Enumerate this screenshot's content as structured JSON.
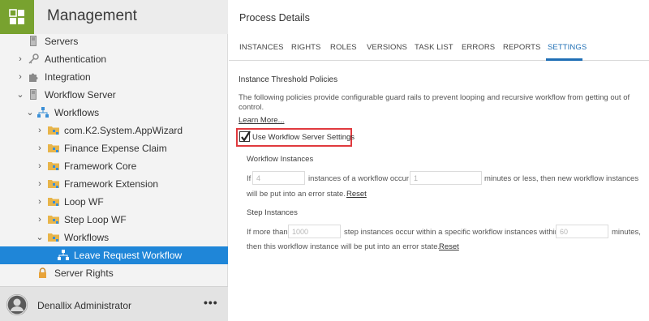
{
  "sidebar": {
    "title": "Management",
    "brand_color": "#78a22f",
    "selected_color": "#1f86d8",
    "tree": [
      {
        "label": "Servers",
        "icon": "server-icon",
        "chevron": ""
      },
      {
        "label": "Authentication",
        "icon": "key-icon",
        "chevron": "›"
      },
      {
        "label": "Integration",
        "icon": "puzzle-icon",
        "chevron": "›"
      },
      {
        "label": "Workflow Server",
        "icon": "server-icon",
        "chevron": "⌄"
      },
      {
        "label": "Workflows",
        "icon": "workflow-icon",
        "chevron": "⌄"
      },
      {
        "label": "com.K2.System.AppWizard",
        "icon": "folder-workflow-icon",
        "chevron": "›"
      },
      {
        "label": "Finance Expense Claim",
        "icon": "folder-workflow-icon",
        "chevron": "›"
      },
      {
        "label": "Framework Core",
        "icon": "folder-workflow-icon",
        "chevron": "›"
      },
      {
        "label": "Framework Extension",
        "icon": "folder-workflow-icon",
        "chevron": "›"
      },
      {
        "label": "Loop WF",
        "icon": "folder-workflow-icon",
        "chevron": "›"
      },
      {
        "label": "Step Loop WF",
        "icon": "folder-workflow-icon",
        "chevron": "›"
      },
      {
        "label": "Workflows",
        "icon": "folder-workflow-icon",
        "chevron": "⌄"
      },
      {
        "label": "Leave Request Workflow",
        "icon": "workflow-icon",
        "chevron": ""
      },
      {
        "label": "Server Rights",
        "icon": "lock-icon",
        "chevron": ""
      }
    ],
    "user": {
      "name": "Denallix Administrator",
      "more": "•••"
    }
  },
  "main": {
    "title": "Process Details",
    "tabs": [
      "INSTANCES",
      "RIGHTS",
      "ROLES",
      "VERSIONS",
      "TASK LIST",
      "ERRORS",
      "REPORTS",
      "SETTINGS"
    ],
    "active_tab": "SETTINGS",
    "accent_color": "#1f6fb5",
    "settings": {
      "section_title": "Instance Threshold Policies",
      "description": "The following policies provide configurable guard rails to prevent looping and recursive workflow from getting out of control.",
      "learn_more": "Learn More...",
      "checkbox_label": "Use Workflow Server Settings",
      "checkbox_checked": true,
      "workflow_instances": {
        "title": "Workflow Instances",
        "prefix": "If",
        "instances_value": "4",
        "middle": "instances of a workflow occur within",
        "minutes_value": "1",
        "suffix": "minutes or less, then new workflow instances",
        "line2": "will be put into an error state.",
        "reset": "Reset"
      },
      "step_instances": {
        "title": "Step Instances",
        "prefix": "If more than",
        "instances_value": "1000",
        "middle": "step instances occur within a specific workflow instances within",
        "minutes_value": "60",
        "suffix": "minutes,",
        "line2": "then this workflow instance will be put into an error state.",
        "reset": "Reset"
      }
    }
  }
}
